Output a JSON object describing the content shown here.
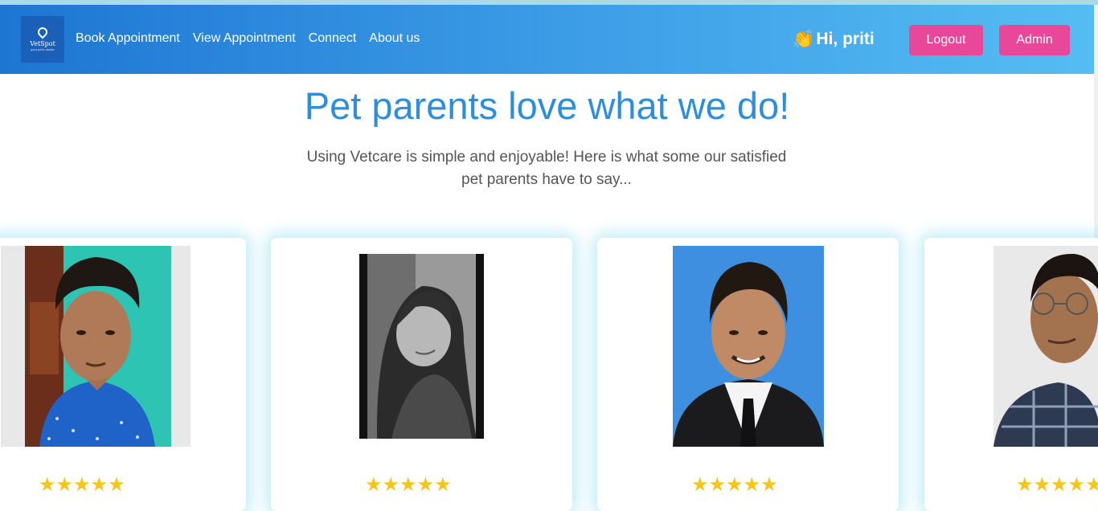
{
  "navbar": {
    "logo_text": "VetSpot",
    "logo_tagline": "your pet's doctor",
    "links": [
      "Book Appointment",
      "View Appointment",
      "Connect",
      "About us"
    ],
    "greeting_icon": "👏",
    "greeting": "Hi, priti",
    "logout_label": "Logout",
    "admin_label": "Admin"
  },
  "main": {
    "title": "Pet parents love what we do!",
    "subtitle_line1": "Using Vetcare is simple and enjoyable! Here is what some our satisfied",
    "subtitle_line2": "pet parents have to say..."
  },
  "testimonials": [
    {
      "rating": 5,
      "stars": "★★★★★"
    },
    {
      "rating": 5,
      "stars": "★★★★★"
    },
    {
      "rating": 5,
      "stars": "★★★★★"
    },
    {
      "rating": 5,
      "stars": "★★★★★"
    }
  ],
  "colors": {
    "nav_start": "#1d76d2",
    "nav_end": "#55bdf2",
    "accent_pink": "#e8479a",
    "title_blue": "#2d8fdc",
    "star": "#f5c518"
  }
}
